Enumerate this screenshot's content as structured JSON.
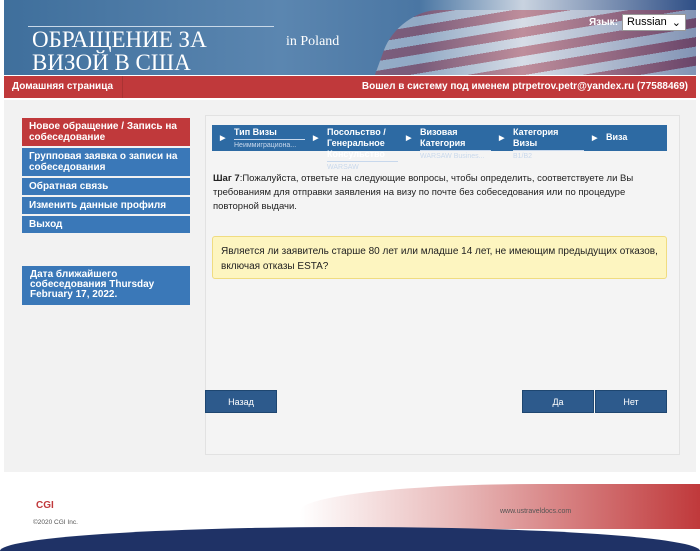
{
  "header": {
    "title_line1": "ОБРАЩЕНИЕ ЗА",
    "title_line2": "ВИЗОЙ В США",
    "country": "in Poland",
    "language_label": "Язык:",
    "language_value": "Russian"
  },
  "topbar": {
    "home": "Домашняя страница",
    "logged_in": "Вошел в систему под именем  ptrpetrov.petr@yandex.ru (77588469)"
  },
  "sidebar": {
    "items": [
      {
        "label": "Новое обращение / Запись на собеседование",
        "active": true
      },
      {
        "label": "Групповая заявка о записи на собеседования"
      },
      {
        "label": "Обратная связь"
      },
      {
        "label": "Изменить данные профиля"
      },
      {
        "label": "Выход"
      }
    ],
    "appointment": "Дата ближайшего собеседования Thursday February 17, 2022."
  },
  "breadcrumb": [
    {
      "label": "Тип Визы",
      "value": "Неиммиграциона..."
    },
    {
      "label": "Посольство / Генеральное Консульство",
      "value": "WARSAW"
    },
    {
      "label": "Визовая Категория",
      "value": "WARSAW Busines..."
    },
    {
      "label": "Категория Визы",
      "value": "B1/B2"
    },
    {
      "label": "Виза",
      "value": ""
    }
  ],
  "step": {
    "label": "Шаг 7",
    "text": ":Пожалуйста, ответьте на следующие вопросы, чтобы определить, соответствуете ли Вы требованиям для отправки заявления на визу по почте без собеседования или по процедуре повторной выдачи."
  },
  "question": "Является ли заявитель старше 80 лет или младше 14 лет, не имеющим предыдущих отказов, включая отказы ESTA?",
  "buttons": {
    "back": "Назад",
    "yes": "Да",
    "no": "Нет"
  },
  "footer": {
    "logo": "CGI",
    "copyright": "©2020 CGI Inc.",
    "url": "www.ustraveldocs.com"
  },
  "colors": {
    "red": "#c0393b",
    "blue": "#3a78b8",
    "dark_blue": "#2d5a8c",
    "question_bg": "#fdf5c0"
  }
}
